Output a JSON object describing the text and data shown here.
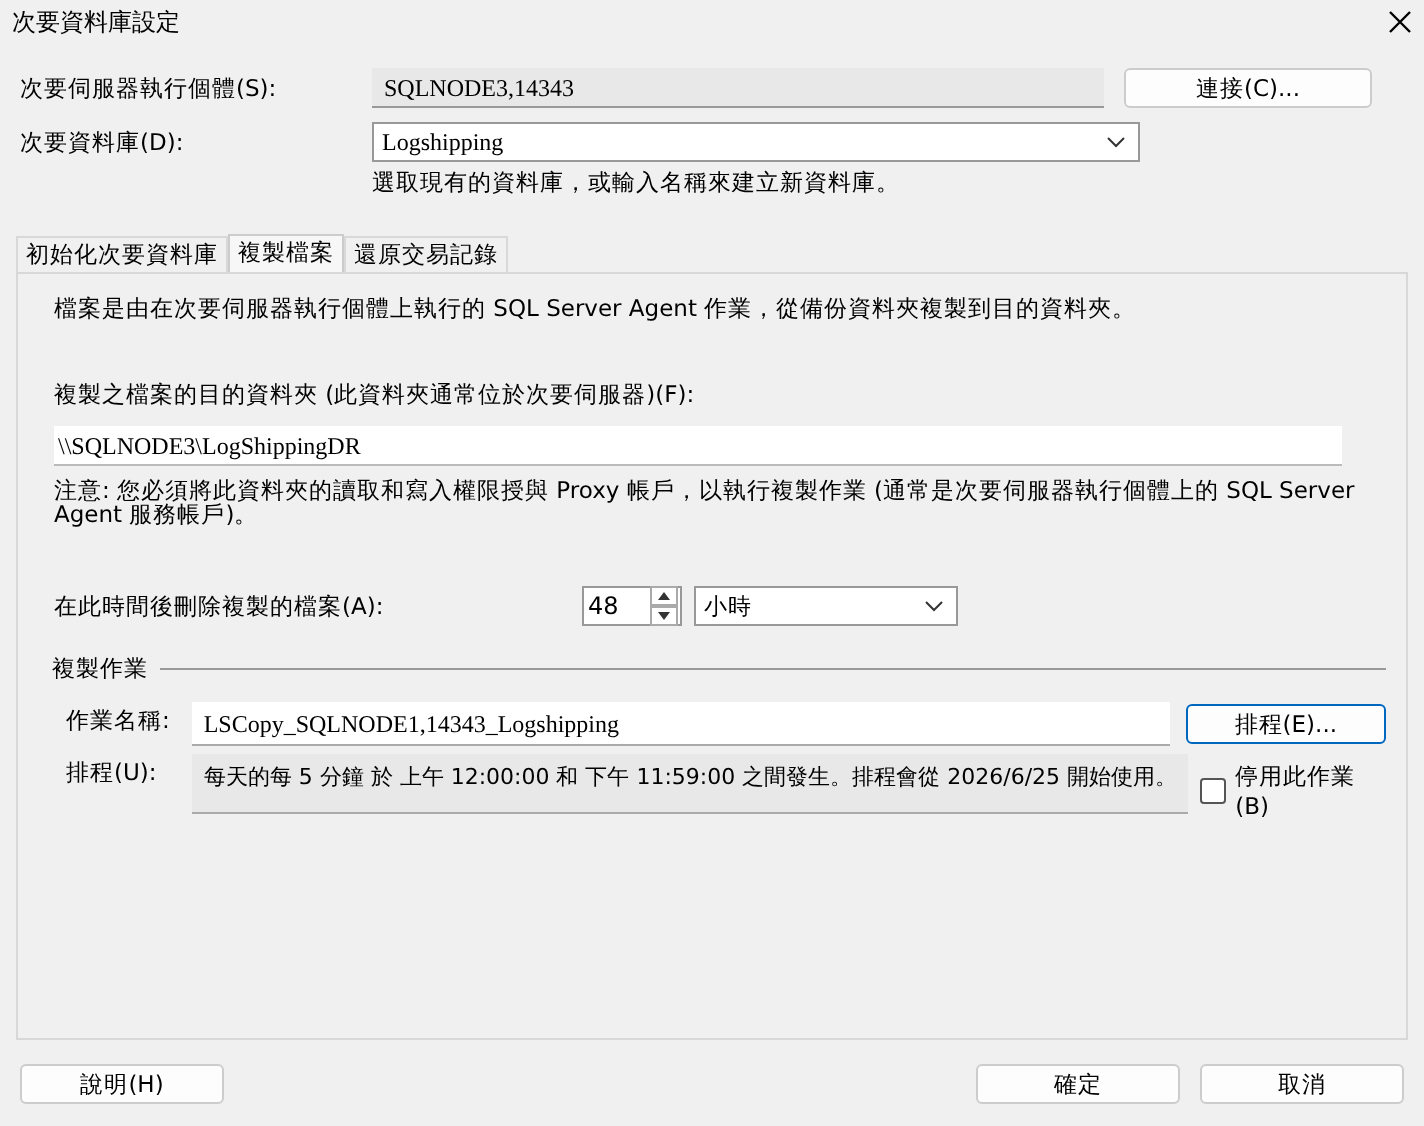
{
  "window": {
    "title": "次要資料庫設定"
  },
  "server": {
    "label": "次要伺服器執行個體(S):",
    "value": "SQLNODE3,14343",
    "button": "連接(C)..."
  },
  "database": {
    "label": "次要資料庫(D):",
    "value": "Logshipping",
    "hint": "選取現有的資料庫，或輸入名稱來建立新資料庫。"
  },
  "tabs": [
    {
      "label": "初始化次要資料庫",
      "selected": false
    },
    {
      "label": "複製檔案",
      "selected": true
    },
    {
      "label": "還原交易記錄",
      "selected": false
    }
  ],
  "panel": {
    "description": "檔案是由在次要伺服器執行個體上執行的 SQL Server Agent 作業，從備份資料夾複製到目的資料夾。",
    "folder_label": "複製之檔案的目的資料夾 (此資料夾通常位於次要伺服器)(F):",
    "folder_value": "\\\\SQLNODE3\\LogShippingDR",
    "note": "注意: 您必須將此資料夾的讀取和寫入權限授與 Proxy 帳戶，以執行複製作業 (通常是次要伺服器執行個體上的 SQL Server Agent 服務帳戶)。",
    "delete_label": "在此時間後刪除複製的檔案(A):",
    "delete_value": "48",
    "delete_unit": "小時",
    "job_group": "複製作業",
    "job_name_label": "作業名稱:",
    "job_name": "LSCopy_SQLNODE1,14343_Logshipping",
    "schedule_button": "排程(E)...",
    "schedule_label": "排程(U):",
    "schedule": "每天的每 5 分鐘 於 上午 12:00:00 和 下午 11:59:00 之間發生。排程會從 2026/6/25 開始使用。",
    "disable_label": "停用此作業(B)",
    "disable_checked": false
  },
  "buttons": {
    "help": "說明(H)",
    "ok": "確定",
    "cancel": "取消"
  }
}
